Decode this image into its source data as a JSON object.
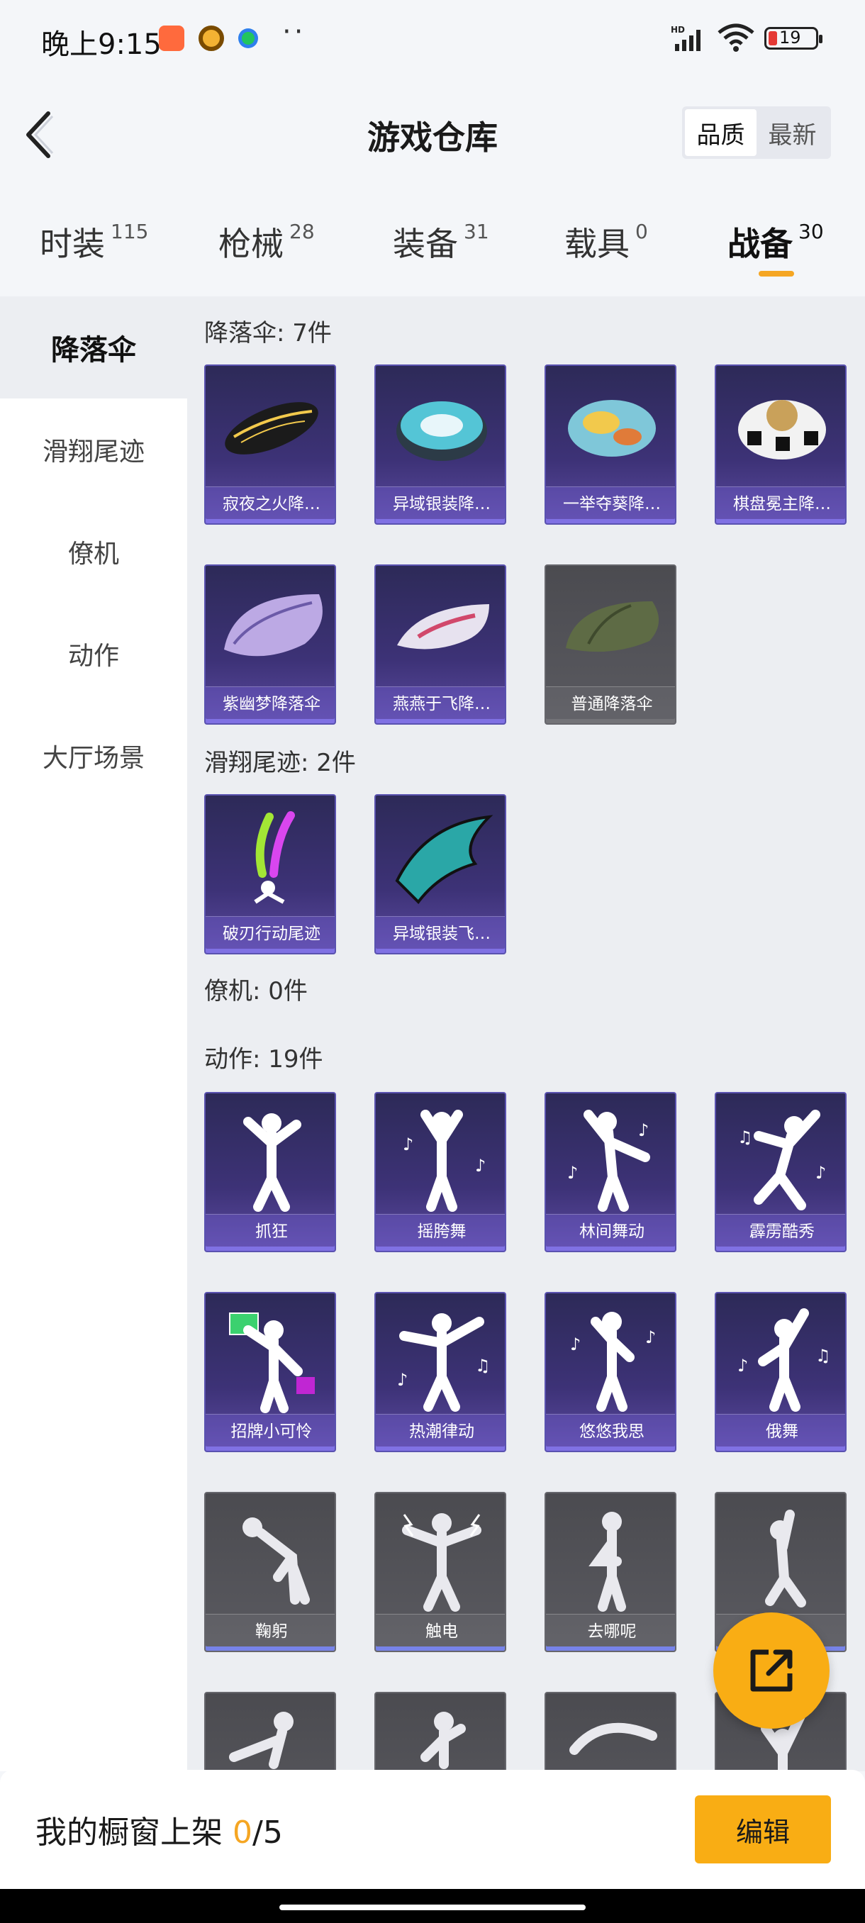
{
  "status_bar": {
    "time": "晚上9:15",
    "dots": "··",
    "battery": "19"
  },
  "header": {
    "title": "游戏仓库",
    "sort_options": [
      "品质",
      "最新"
    ],
    "sort_active": "品质"
  },
  "tabs": [
    {
      "label": "时装",
      "count": "115"
    },
    {
      "label": "枪械",
      "count": "28"
    },
    {
      "label": "装备",
      "count": "31"
    },
    {
      "label": "载具",
      "count": "0"
    },
    {
      "label": "战备",
      "count": "30",
      "active": true
    }
  ],
  "sidebar": [
    {
      "label": "降落伞",
      "active": true
    },
    {
      "label": "滑翔尾迹"
    },
    {
      "label": "僚机"
    },
    {
      "label": "动作"
    },
    {
      "label": "大厅场景"
    }
  ],
  "sections": {
    "parachute": {
      "title": "降落伞: 7件",
      "items": [
        "寂夜之火降…",
        "异域银装降…",
        "一举夺葵降…",
        "棋盘冕主降…",
        "紫幽梦降落伞",
        "燕燕于飞降…",
        "普通降落伞"
      ]
    },
    "trail": {
      "title": "滑翔尾迹: 2件",
      "items": [
        "破刃行动尾迹",
        "异域银装飞…"
      ]
    },
    "wingman": {
      "title": "僚机: 0件"
    },
    "emote": {
      "title": "动作: 19件",
      "items": [
        "抓狂",
        "摇胯舞",
        "林间舞动",
        "霹雳酷秀",
        "招牌小可怜",
        "热潮律动",
        "悠悠我思",
        "俄舞",
        "鞠躬",
        "触电",
        "去哪呢"
      ]
    }
  },
  "bottom_bar": {
    "shelf_label": "我的橱窗上架",
    "shelf_current": "0",
    "shelf_total": "/5",
    "edit_label": "编辑"
  },
  "colors": {
    "accent": "#f9ad14",
    "card_purple": "#3d3277",
    "card_gray": "#55555a"
  }
}
